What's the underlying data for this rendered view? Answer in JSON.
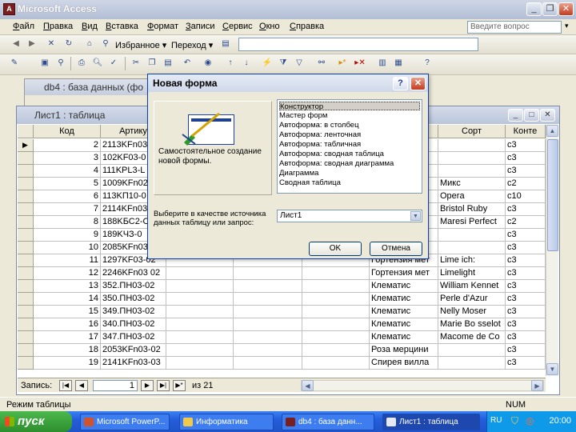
{
  "app": {
    "title": "Microsoft Access",
    "icon": "access-icon"
  },
  "menubar": {
    "items": [
      {
        "key": "Ф",
        "rest": "айл"
      },
      {
        "key": "П",
        "rest": "равка"
      },
      {
        "key": "В",
        "rest": "ид"
      },
      {
        "key": "В",
        "rest": "ставка"
      },
      {
        "key": "Ф",
        "rest": "ормат"
      },
      {
        "key": "З",
        "rest": "аписи"
      },
      {
        "key": "С",
        "rest": "ервис"
      },
      {
        "key": "О",
        "rest": "кно"
      },
      {
        "key": "С",
        "rest": "правка"
      }
    ],
    "help_placeholder": "Введите вопрос"
  },
  "web_toolbar": {
    "favorites_label": "Избранное",
    "goto_label": "Переход"
  },
  "db_window": {
    "title": "db4 : база данных (фо"
  },
  "table_window": {
    "title": "Лист1 : таблица"
  },
  "grid": {
    "headers": [
      "Код",
      "Артику",
      "",
      "",
      "",
      "ие",
      "Сорт",
      "Конте"
    ],
    "rows": [
      {
        "code": "2",
        "art": "2113KFn03",
        "name": "ы",
        "sort": "",
        "cont": "c3"
      },
      {
        "code": "3",
        "art": "102KF03-0",
        "name": "ы",
        "sort": "",
        "cont": "c3"
      },
      {
        "code": "4",
        "art": "111KPL3-L",
        "name": "од",
        "sort": "",
        "cont": "c3"
      },
      {
        "code": "5",
        "art": "1009KFn02",
        "name": "ди",
        "sort": "Микс",
        "cont": "c2"
      },
      {
        "code": "6",
        "art": "113KП10-0",
        "name": "ди",
        "sort": "Opera",
        "cont": "c10"
      },
      {
        "code": "7",
        "art": "2114KFn03",
        "name": "ур",
        "sort": "Bristol Ruby",
        "cont": "c3"
      },
      {
        "code": "8",
        "art": "188KБС2-С",
        "name": "ур",
        "sort": "Maresi Perfect",
        "cont": "c2"
      },
      {
        "code": "9",
        "art": "189KЧЗ-0",
        "name": "ур",
        "sort": "",
        "cont": "c3"
      },
      {
        "code": "10",
        "art": "2085KFn03",
        "name": "ур",
        "sort": "",
        "cont": "c3"
      },
      {
        "code": "11",
        "art": "1297KF03-02",
        "name": "Гортензия мет",
        "sort": "Lime ich:",
        "cont": "c3"
      },
      {
        "code": "12",
        "art": "2246KFn03 02",
        "name": "Гортензия мет",
        "sort": "Limelight",
        "cont": "c3"
      },
      {
        "code": "13",
        "art": "352.ПН03-02",
        "name": "Клематис",
        "sort": "William Kennet",
        "cont": "c3"
      },
      {
        "code": "14",
        "art": "350.ПН03-02",
        "name": "Клематис",
        "sort": "Perle d'Azur",
        "cont": "c3"
      },
      {
        "code": "15",
        "art": "349.ПН03-02",
        "name": "Клематис",
        "sort": "Nelly Moser",
        "cont": "c3"
      },
      {
        "code": "16",
        "art": "340.ПН03-02",
        "name": "Клематис",
        "sort": "Marie Bo sselot",
        "cont": "c3"
      },
      {
        "code": "17",
        "art": "347.ПН03-02",
        "name": "Клематис",
        "sort": "Macome de Co",
        "cont": "c3"
      },
      {
        "code": "18",
        "art": "2053KFn03-02",
        "name": "Роза мерцини",
        "sort": "",
        "cont": "c3"
      },
      {
        "code": "19",
        "art": "2141KFn03-03",
        "name": "Спирея вилла",
        "sort": "",
        "cont": "c3"
      }
    ]
  },
  "nav": {
    "label": "Запись:",
    "current": "1",
    "of_label": "из 21"
  },
  "dialog": {
    "title": "Новая форма",
    "description": "Самостоятельное создание новой формы.",
    "options": [
      "Конструктор",
      "Мастер форм",
      "Автоформа: в столбец",
      "Автоформа: ленточная",
      "Автоформа: табличная",
      "Автоформа: сводная таблица",
      "Автоформа: сводная диаграмма",
      "Диаграмма",
      "Сводная таблица"
    ],
    "source_label": "Выберите в качестве источника данных таблицу или запрос:",
    "source_value": "Лист1",
    "ok_label": "OK",
    "cancel_label": "Отмена"
  },
  "statusbar": {
    "mode": "Режим таблицы",
    "num": "NUM"
  },
  "taskbar": {
    "start_label": "пуск",
    "items": [
      {
        "label": "Microsoft PowerP...",
        "icon": "powerpoint-icon"
      },
      {
        "label": "Информатика",
        "icon": "folder-icon"
      },
      {
        "label": "db4 : база данн...",
        "icon": "access-db-icon"
      },
      {
        "label": "Лист1 : таблица",
        "icon": "table-icon"
      }
    ],
    "lang": "RU",
    "clock": "20:00"
  },
  "colors": {
    "titlebar": "#b3bfd6",
    "taskbar": "#245edb",
    "dialog_border": "#0b3fb8",
    "close_red": "#c43b1f"
  }
}
